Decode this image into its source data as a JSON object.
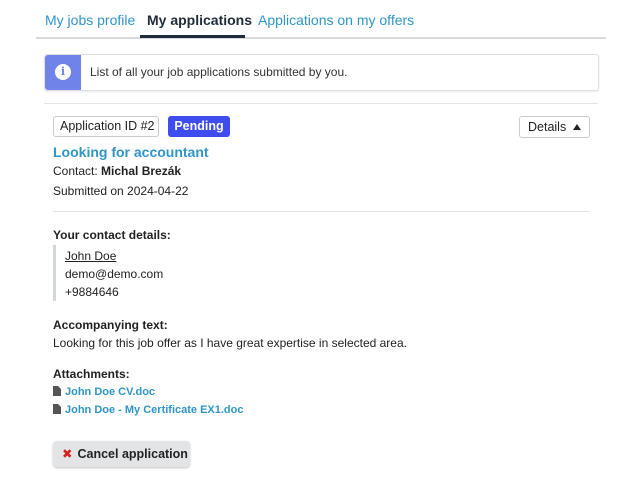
{
  "tabs": [
    {
      "label": "My jobs profile"
    },
    {
      "label": "My applications"
    },
    {
      "label": "Applications on my offers"
    }
  ],
  "info": {
    "icon": "info-icon",
    "text": "List of all your job applications submitted by you.",
    "accent": "#6f83e9"
  },
  "application": {
    "id_label": "Application ID #2",
    "status": "Pending",
    "status_color": "#3f4df0",
    "details_label": "Details",
    "title": "Looking for accountant",
    "contact_label": "Contact:",
    "contact_name": "Michal Brezák",
    "submitted": "Submitted on 2024-04-22"
  },
  "contact_details": {
    "title": "Your contact details:",
    "name": "John Doe",
    "email": "demo@demo.com",
    "phone": "+9884646"
  },
  "accompanying": {
    "title": "Accompanying text:",
    "text": "Looking for this job offer as I have great expertise in selected area."
  },
  "attachments": {
    "title": "Attachments:",
    "files": [
      {
        "name": "John Doe CV.doc"
      },
      {
        "name": "John Doe - My Certificate EX1.doc"
      }
    ]
  },
  "cancel": {
    "label": "Cancel application",
    "icon": "x-icon"
  }
}
